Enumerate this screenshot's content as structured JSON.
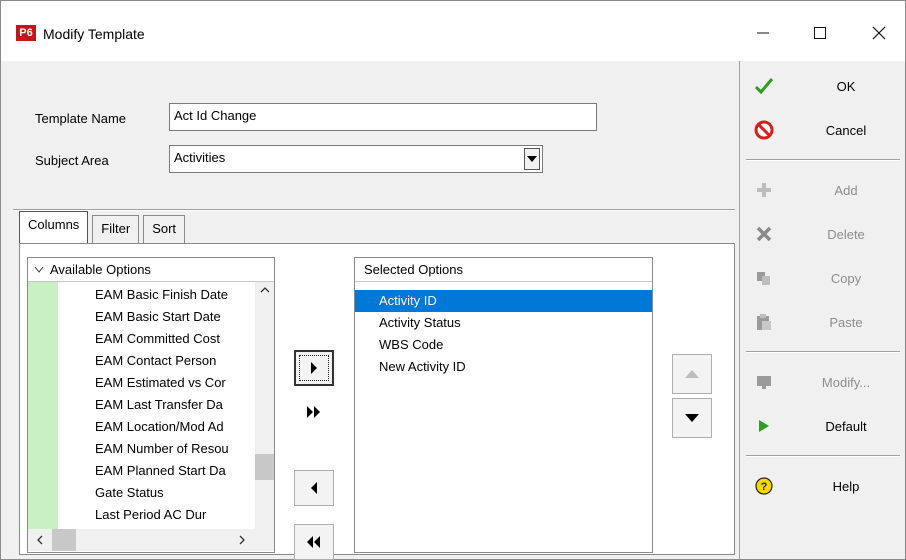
{
  "window": {
    "title": "Modify Template",
    "app_icon_text": "P6",
    "controls": {
      "minimize": "minimize-icon",
      "maximize": "maximize-icon",
      "close": "close-icon"
    }
  },
  "form": {
    "template_name_label": "Template Name",
    "template_name_value": "Act Id Change",
    "subject_area_label": "Subject Area",
    "subject_area_value": "Activities"
  },
  "tabs": [
    {
      "label": "Columns",
      "active": true
    },
    {
      "label": "Filter",
      "active": false
    },
    {
      "label": "Sort",
      "active": false
    }
  ],
  "available": {
    "header": "Available Options",
    "items": [
      "EAM Basic Finish Date",
      "EAM Basic Start Date",
      "EAM Committed Cost",
      "EAM Contact Person",
      "EAM Estimated vs Cor",
      "EAM Last Transfer Da",
      "EAM Location/Mod Ad",
      "EAM Number of Resou",
      "EAM Planned Start Da",
      "Gate Status",
      "Last Period AC Dur"
    ]
  },
  "selected": {
    "header": "Selected Options",
    "items": [
      "Activity ID",
      "Activity Status",
      "WBS Code",
      "New Activity ID"
    ],
    "selected_index": 0
  },
  "side_buttons": [
    {
      "label": "OK",
      "icon": "checkmark-icon",
      "enabled": true
    },
    {
      "label": "Cancel",
      "icon": "cancel-icon",
      "enabled": true
    },
    {
      "label": "Add",
      "icon": "add-icon",
      "enabled": false
    },
    {
      "label": "Delete",
      "icon": "delete-icon",
      "enabled": false
    },
    {
      "label": "Copy",
      "icon": "copy-icon",
      "enabled": false
    },
    {
      "label": "Paste",
      "icon": "paste-icon",
      "enabled": false
    },
    {
      "label": "Modify...",
      "icon": "modify-icon",
      "enabled": false
    },
    {
      "label": "Default",
      "icon": "play-icon",
      "enabled": true
    },
    {
      "label": "Help",
      "icon": "help-icon",
      "enabled": true
    }
  ],
  "colors": {
    "selection": "#0078d7",
    "green_strip": "#c8f0c4",
    "ok_green": "#2e9e1e",
    "cancel_red": "#d81e1e",
    "app_icon_red": "#c4161c"
  }
}
